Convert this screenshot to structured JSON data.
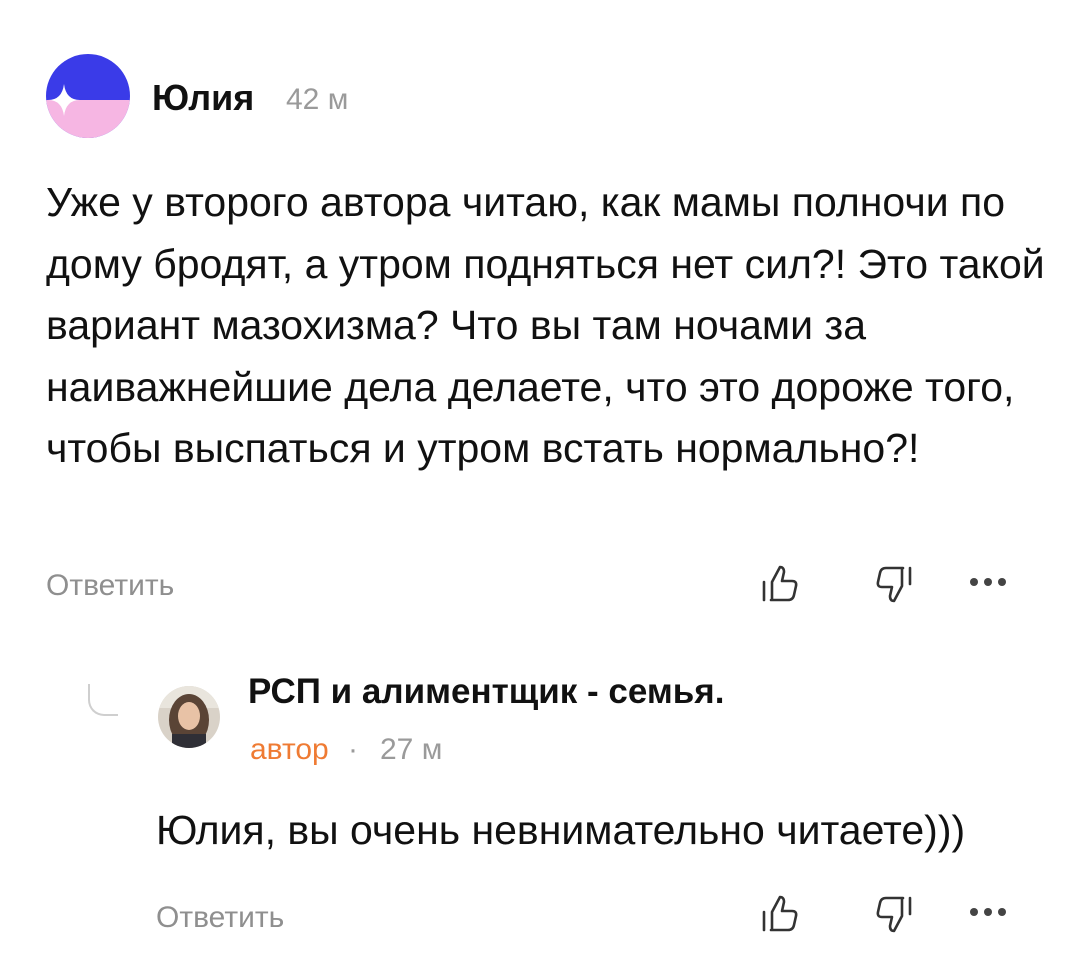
{
  "comment": {
    "author": "Юлия",
    "time": "42 м",
    "text": "Уже у второго автора читаю, как мамы полночи по дому бродят, а утром подняться нет сил?! Это такой вариант мазохизма? Что вы там ночами за наиважнейшие дела делаете, что это дороже того, чтобы выспаться и утром встать нормально?!",
    "reply_label": "Ответить",
    "icons": {
      "avatar": "avatar-icon",
      "like": "thumbs-up-icon",
      "dislike": "thumbs-down-icon",
      "more": "more-dots-icon"
    }
  },
  "reply": {
    "author": "РСП и алиментщик - семья.",
    "badge": "автор",
    "separator": "·",
    "time": "27 м",
    "text": "Юлия, вы очень невнимательно читаете)))",
    "reply_label": "Ответить",
    "icons": {
      "avatar": "avatar-photo",
      "like": "thumbs-up-icon",
      "dislike": "thumbs-down-icon",
      "more": "more-dots-icon"
    }
  },
  "colors": {
    "author_badge": "#ef7b33",
    "muted": "#9a9a9a",
    "avatar_blue": "#3a3be8",
    "avatar_pink": "#f6b6e3"
  }
}
